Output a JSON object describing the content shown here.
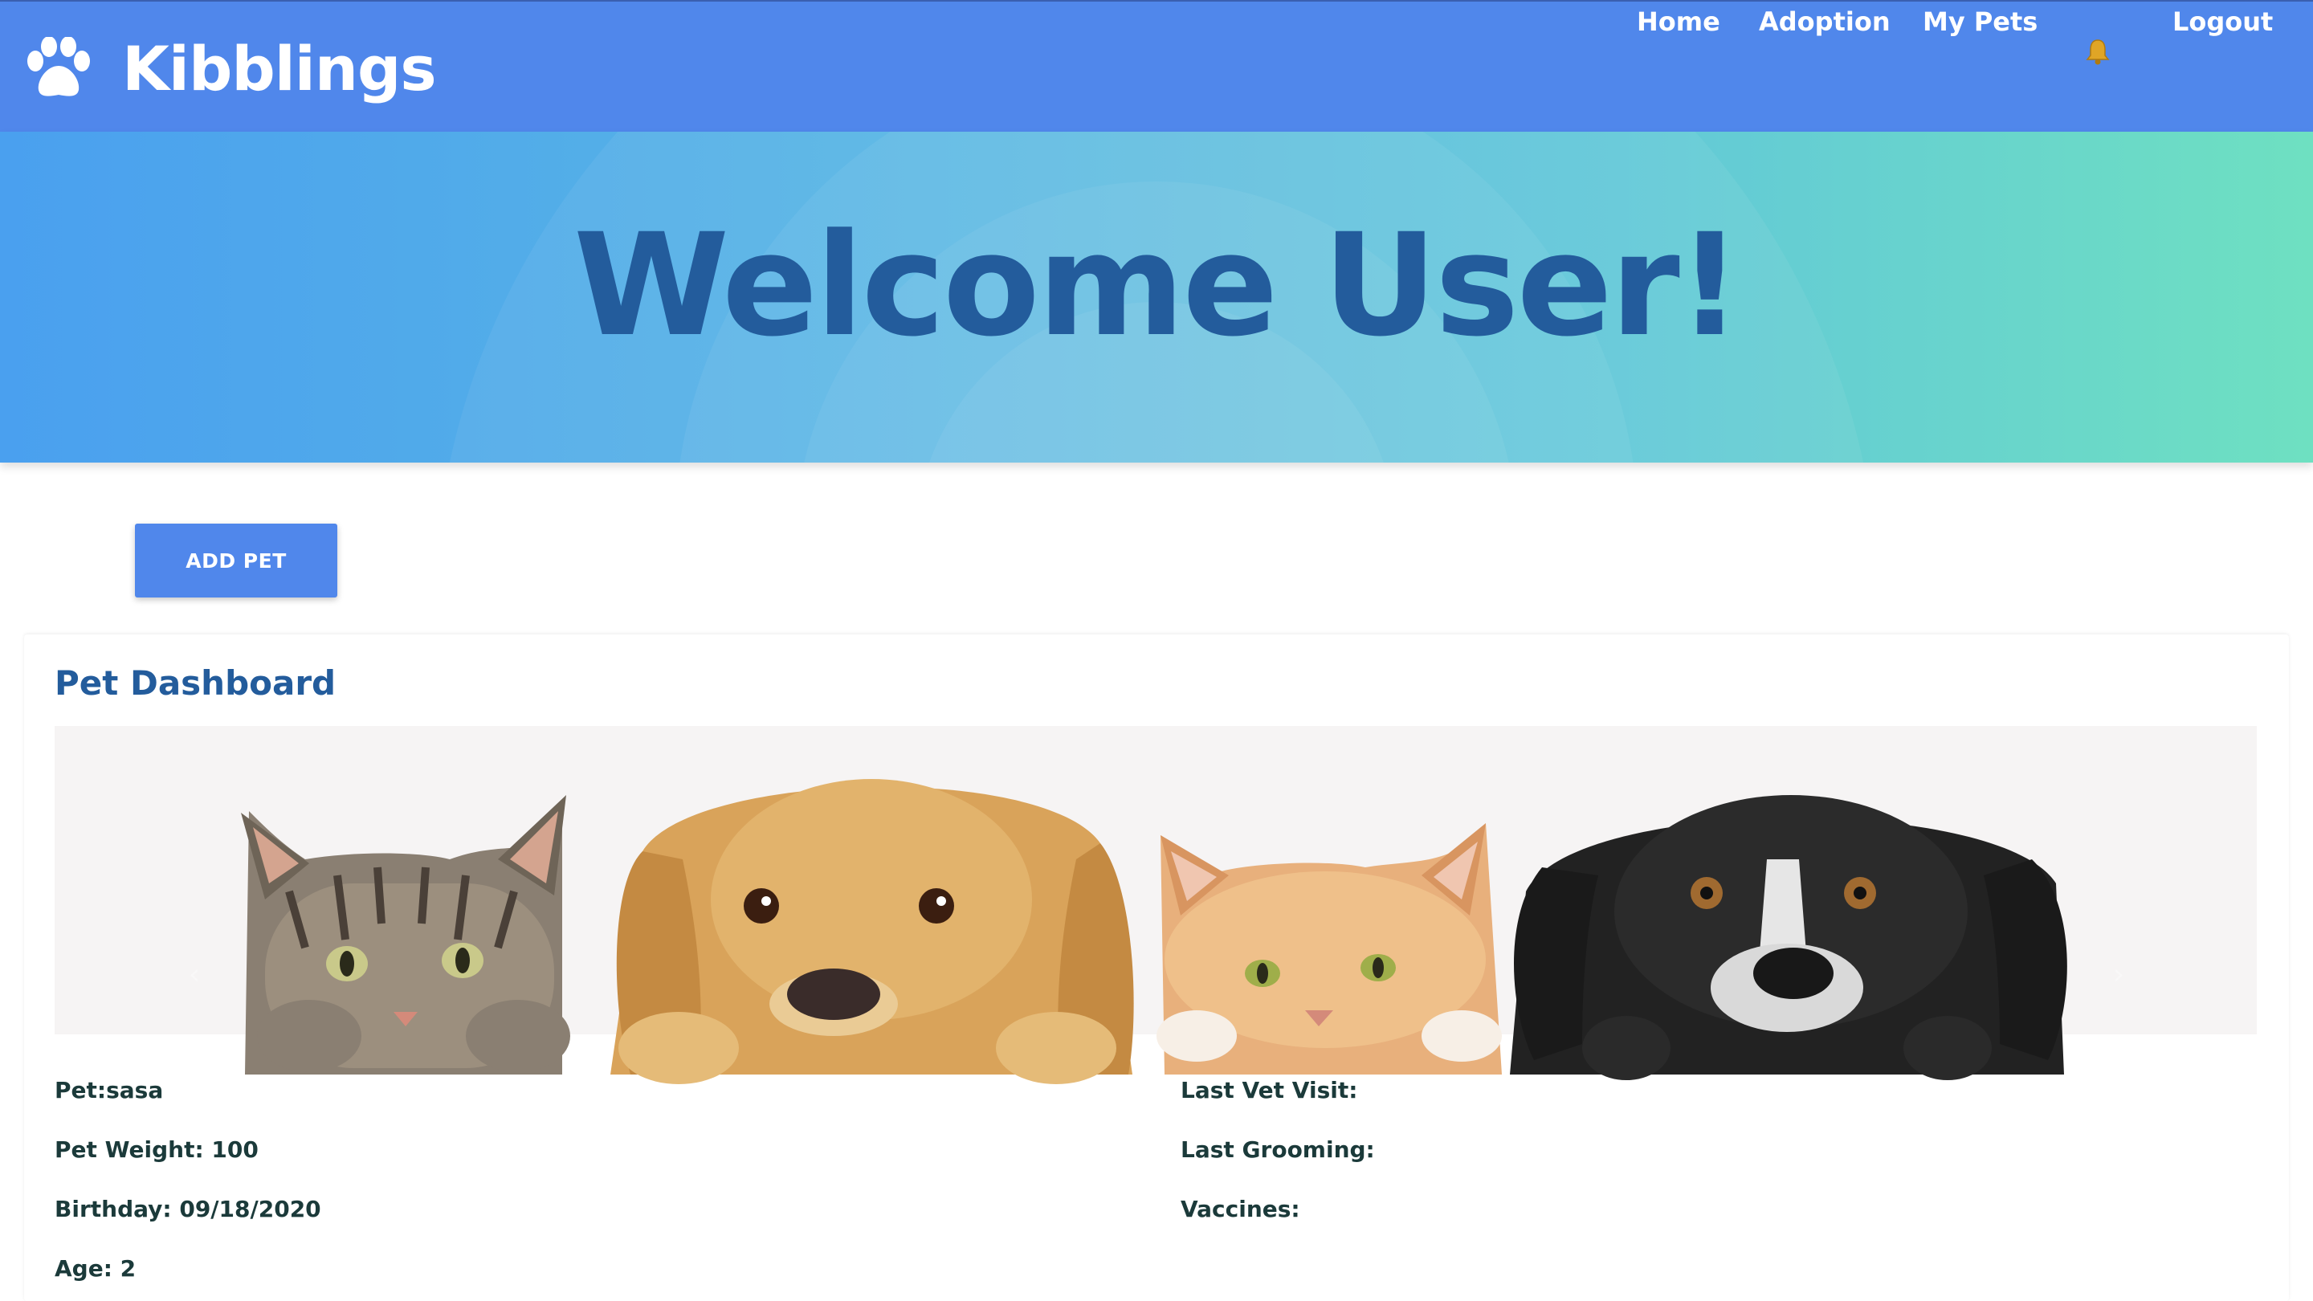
{
  "nav": {
    "brand": "Kibblings",
    "links": [
      "Home",
      "Adoption",
      "My Pets",
      "Logout"
    ]
  },
  "hero": {
    "title": "Welcome User!"
  },
  "actions": {
    "add_pet": "ADD PET"
  },
  "dashboard": {
    "title": "Pet Dashboard",
    "left": [
      "Pet:sasa",
      "Pet Weight: 100",
      "Birthday: 09/18/2020",
      "Age: 2"
    ],
    "right": [
      "Last Vet Visit:",
      "Last Grooming:",
      "Vaccines:"
    ]
  },
  "colors": {
    "navbar": "#5087eb",
    "hero_start": "#4aa0ef",
    "hero_end": "#6ee0c1",
    "title_blue": "#235c9c",
    "text_dark": "#1b3a3a"
  },
  "icons": [
    "paw-icon",
    "bell-icon"
  ]
}
